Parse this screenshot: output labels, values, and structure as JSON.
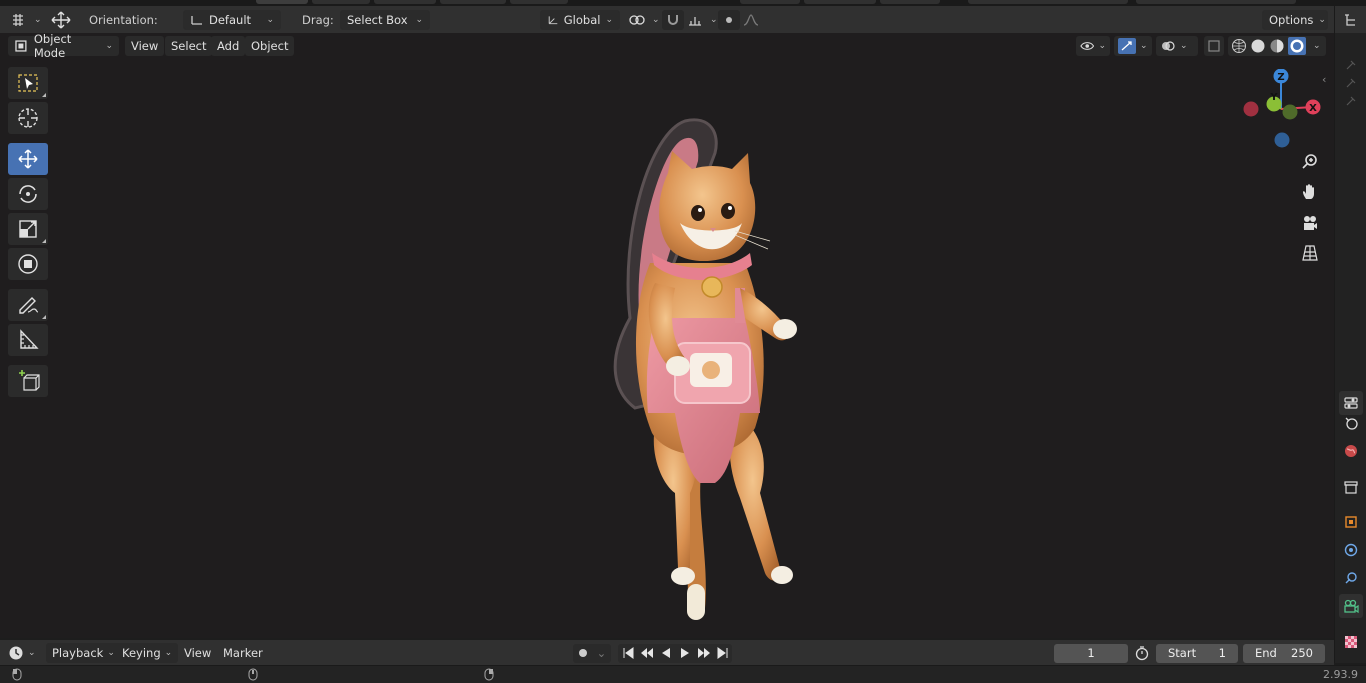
{
  "header": {
    "orientation_label": "Orientation:",
    "orientation_value": "Default",
    "drag_label": "Drag:",
    "drag_value": "Select Box",
    "transform_space": "Global",
    "options_label": "Options"
  },
  "viewport_header": {
    "mode": "Object Mode",
    "menus": [
      "View",
      "Select",
      "Add",
      "Object"
    ]
  },
  "toolbar": {
    "tools": [
      "select-box",
      "cursor",
      "move",
      "rotate",
      "scale",
      "transform",
      "annotate",
      "measure",
      "add-cube"
    ],
    "active": "move"
  },
  "gizmo": {
    "axes": {
      "x": "X",
      "y": "Y",
      "z": "Z"
    },
    "colors": {
      "x": "#e0405a",
      "y": "#8bbf36",
      "z": "#3b87d9",
      "neg_x": "#a03040",
      "neg_y": "#4f6b2a",
      "neg_z": "#2f5f96"
    }
  },
  "timeline": {
    "menus": [
      "Playback",
      "Keying",
      "View",
      "Marker"
    ],
    "current_frame": "1",
    "start_label": "Start",
    "start_value": "1",
    "end_label": "End",
    "end_value": "250"
  },
  "status": {
    "version": "2.93.9"
  },
  "colors": {
    "accent": "#4772b3",
    "header_bg": "#303030",
    "viewport_bg": "#1f1d1e"
  }
}
